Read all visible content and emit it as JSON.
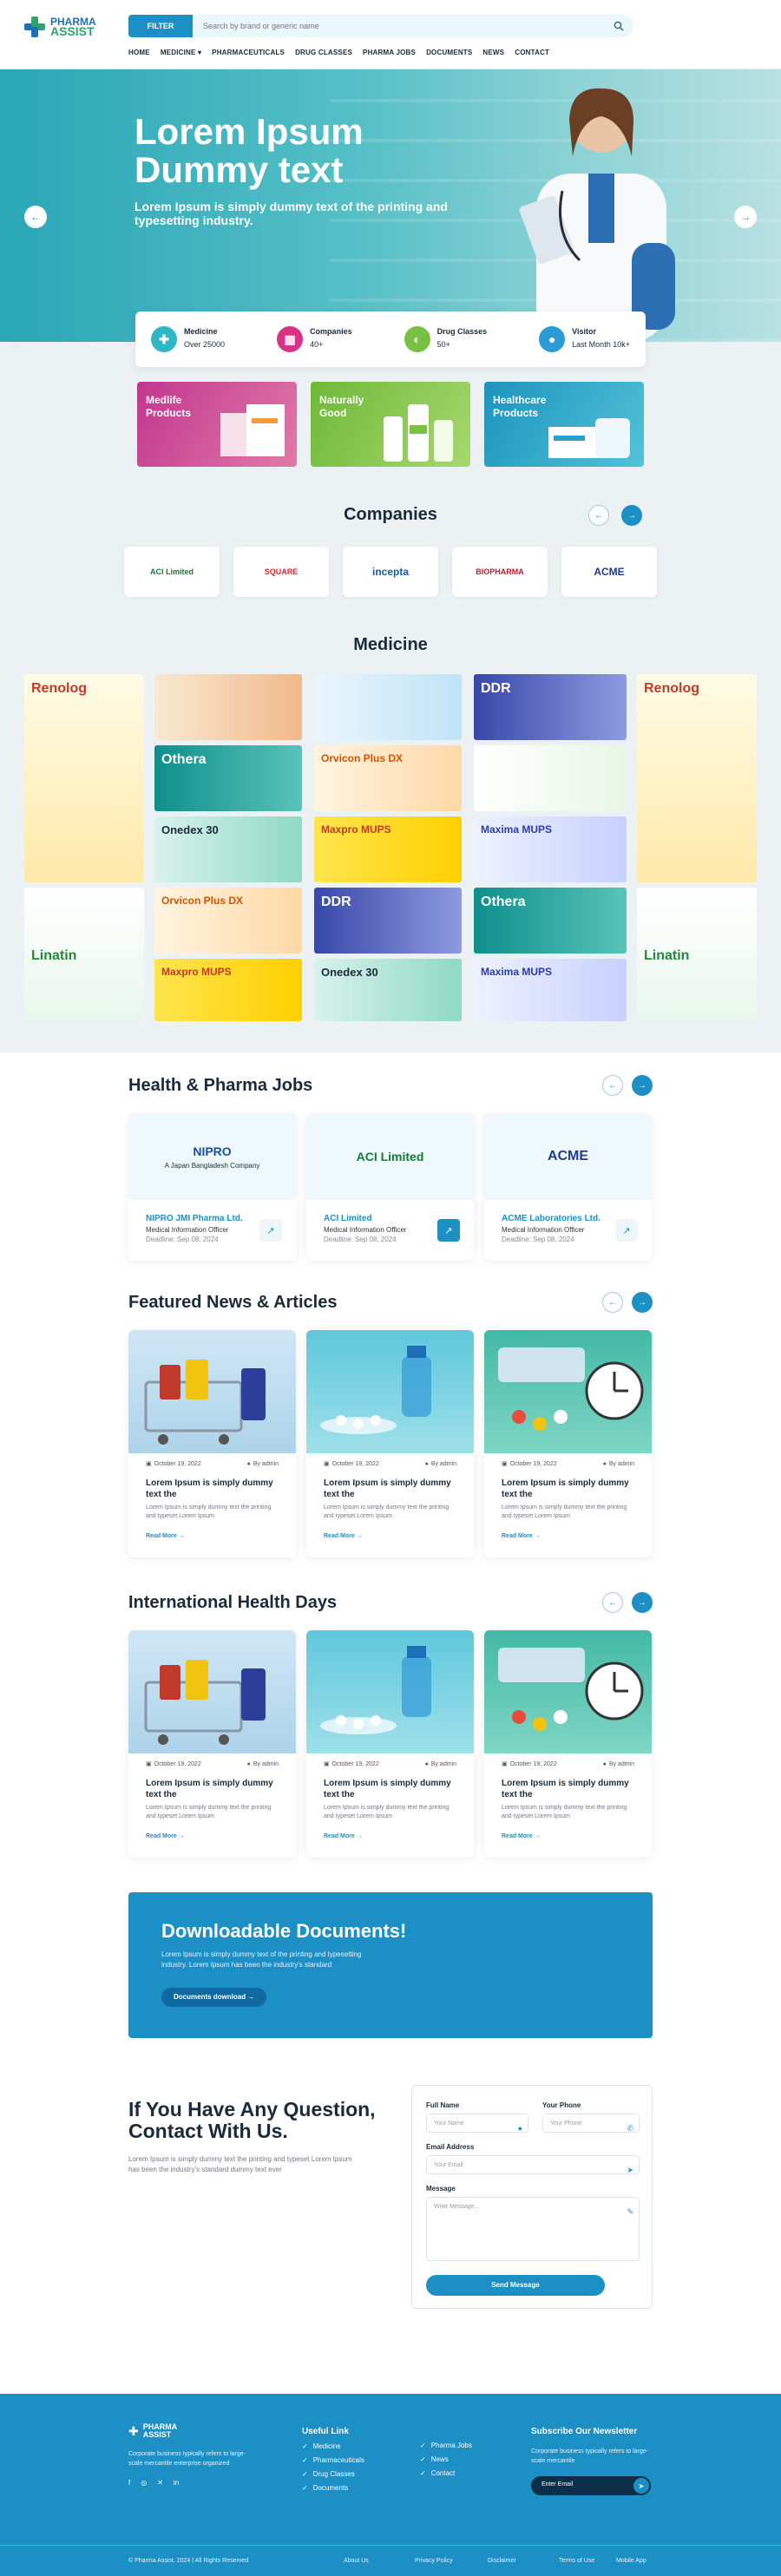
{
  "header": {
    "logo_top": "PHARMA",
    "logo_bottom": "ASSIST",
    "filter_label": "FILTER",
    "search_placeholder": "Search by brand or generic name",
    "nav": [
      "HOME",
      "MEDICINE ▾",
      "PHARMACEUTICALS",
      "DRUG CLASSES",
      "PHARMA JOBS",
      "DOCUMENTS",
      "NEWS",
      "CONTACT"
    ]
  },
  "hero": {
    "title": "Lorem Ipsum Dummy text",
    "subtitle": "Lorem Ipsum is simply dummy text of the printing and typesetting industry."
  },
  "stats": [
    {
      "label": "Medicine",
      "value": "Over 25000",
      "color": "#2fb6c7"
    },
    {
      "label": "Companies",
      "value": "40+",
      "color": "#d63384"
    },
    {
      "label": "Drug Classes",
      "value": "50+",
      "color": "#77c043"
    },
    {
      "label": "Visitor",
      "value": "Last Month 10k+",
      "color": "#2b9bd6"
    }
  ],
  "categories": [
    {
      "label": "Medlife Products",
      "color": "#c2378e"
    },
    {
      "label": "Naturally Good",
      "color": "#7bc142"
    },
    {
      "label": "Healthcare Products",
      "color": "#27a2c4"
    }
  ],
  "companies": {
    "title": "Companies",
    "logos": [
      "ACI Limited",
      "SQUARE",
      "incepta",
      "BIOPHARMA",
      "ACME"
    ]
  },
  "medicine": {
    "title": "Medicine",
    "tiles": [
      "Renolog",
      "Othera",
      "Orvicon Plus DX",
      "DDR",
      "Onedex 30",
      "Maxpro MUPS",
      "Maxima MUPS",
      "Linatin"
    ]
  },
  "jobs": {
    "title": "Health & Pharma Jobs",
    "items": [
      {
        "logo": "NIPRO",
        "tagline": "A Japan Bangladesh Company",
        "name": "NIPRO JMI Pharma Ltd.",
        "role": "Medical Information Officer",
        "deadline": "Deadline: Sep 08, 2024",
        "filled": false
      },
      {
        "logo": "ACI Limited",
        "tagline": "",
        "name": "ACI Limited",
        "role": "Medical Information Officer",
        "deadline": "Deadline: Sep 08, 2024",
        "filled": true
      },
      {
        "logo": "ACME",
        "tagline": "",
        "name": "ACME Laboratories Ltd.",
        "role": "Medical Information Officer",
        "deadline": "Deadline: Sep 08, 2024",
        "filled": false
      }
    ]
  },
  "news": {
    "title": "Featured News & Articles",
    "items": [
      {
        "date": "October 19, 2022",
        "author": "By admin",
        "title": "Lorem Ipsum is simply dummy text the",
        "text": "Lorem Ipsum is simply dummy text the printing and typeset Lorem Ipsum",
        "more": "Read More"
      },
      {
        "date": "October 19, 2022",
        "author": "By admin",
        "title": "Lorem Ipsum is simply dummy text the",
        "text": "Lorem Ipsum is simply dummy text the printing and typeset Lorem Ipsum",
        "more": "Read More"
      },
      {
        "date": "October 19, 2022",
        "author": "By admin",
        "title": "Lorem Ipsum is simply dummy text the",
        "text": "Lorem Ipsum is simply dummy text the printing and typeset Lorem Ipsum",
        "more": "Read More"
      }
    ]
  },
  "days": {
    "title": "International Health Days",
    "items": [
      {
        "date": "October 19, 2022",
        "author": "By admin",
        "title": "Lorem Ipsum is simply dummy text the",
        "text": "Lorem Ipsum is simply dummy text the printing and typeset Lorem Ipsum",
        "more": "Read More"
      },
      {
        "date": "October 19, 2022",
        "author": "By admin",
        "title": "Lorem Ipsum is simply dummy text the",
        "text": "Lorem Ipsum is simply dummy text the printing and typeset Lorem Ipsum",
        "more": "Read More"
      },
      {
        "date": "October 19, 2022",
        "author": "By admin",
        "title": "Lorem Ipsum is simply dummy text the",
        "text": "Lorem Ipsum is simply dummy text the printing and typeset Lorem Ipsum",
        "more": "Read More"
      }
    ]
  },
  "documents": {
    "title": "Downloadable Documents!",
    "text": "Lorem Ipsum is simply dummy text of the printing and typesetting industry. Lorem Ipsum has been the industry's standard",
    "button": "Documents download →"
  },
  "contact": {
    "title": "If You Have Any Question, Contact With Us.",
    "text": "Lorem Ipsum is simply dummy text the printing and typeset Lorem Ipsum has been the industry's standard dummy text ever",
    "full_name_label": "Full Name",
    "full_name_placeholder": "Your Name",
    "phone_label": "Your Phone",
    "phone_placeholder": "Your Phone",
    "email_label": "Email Address",
    "email_placeholder": "Your Email",
    "message_label": "Message",
    "message_placeholder": "Write Message...",
    "send": "Send Message"
  },
  "footer": {
    "brand_text": "Corporate business typically refers to large-scale mercantile enterprise organized",
    "useful_title": "Useful Link",
    "useful_links": [
      "Medicine",
      "Pharmaceuticals",
      "Drug Classes",
      "Documents"
    ],
    "other_links": [
      "Pharma Jobs",
      "News",
      "Contact"
    ],
    "subscribe_title": "Subscribe Our Newsletter",
    "subscribe_text": "Corporate business typically refers to large-scale mercantile",
    "email_placeholder": "Enter Email",
    "copyright": "© Pharma Assist. 2024 | All Rights Reserved",
    "bottom_links": [
      "About Us",
      "Privacy Policy",
      "Disclaimer",
      "Terms of Use",
      "Mobile App"
    ]
  }
}
